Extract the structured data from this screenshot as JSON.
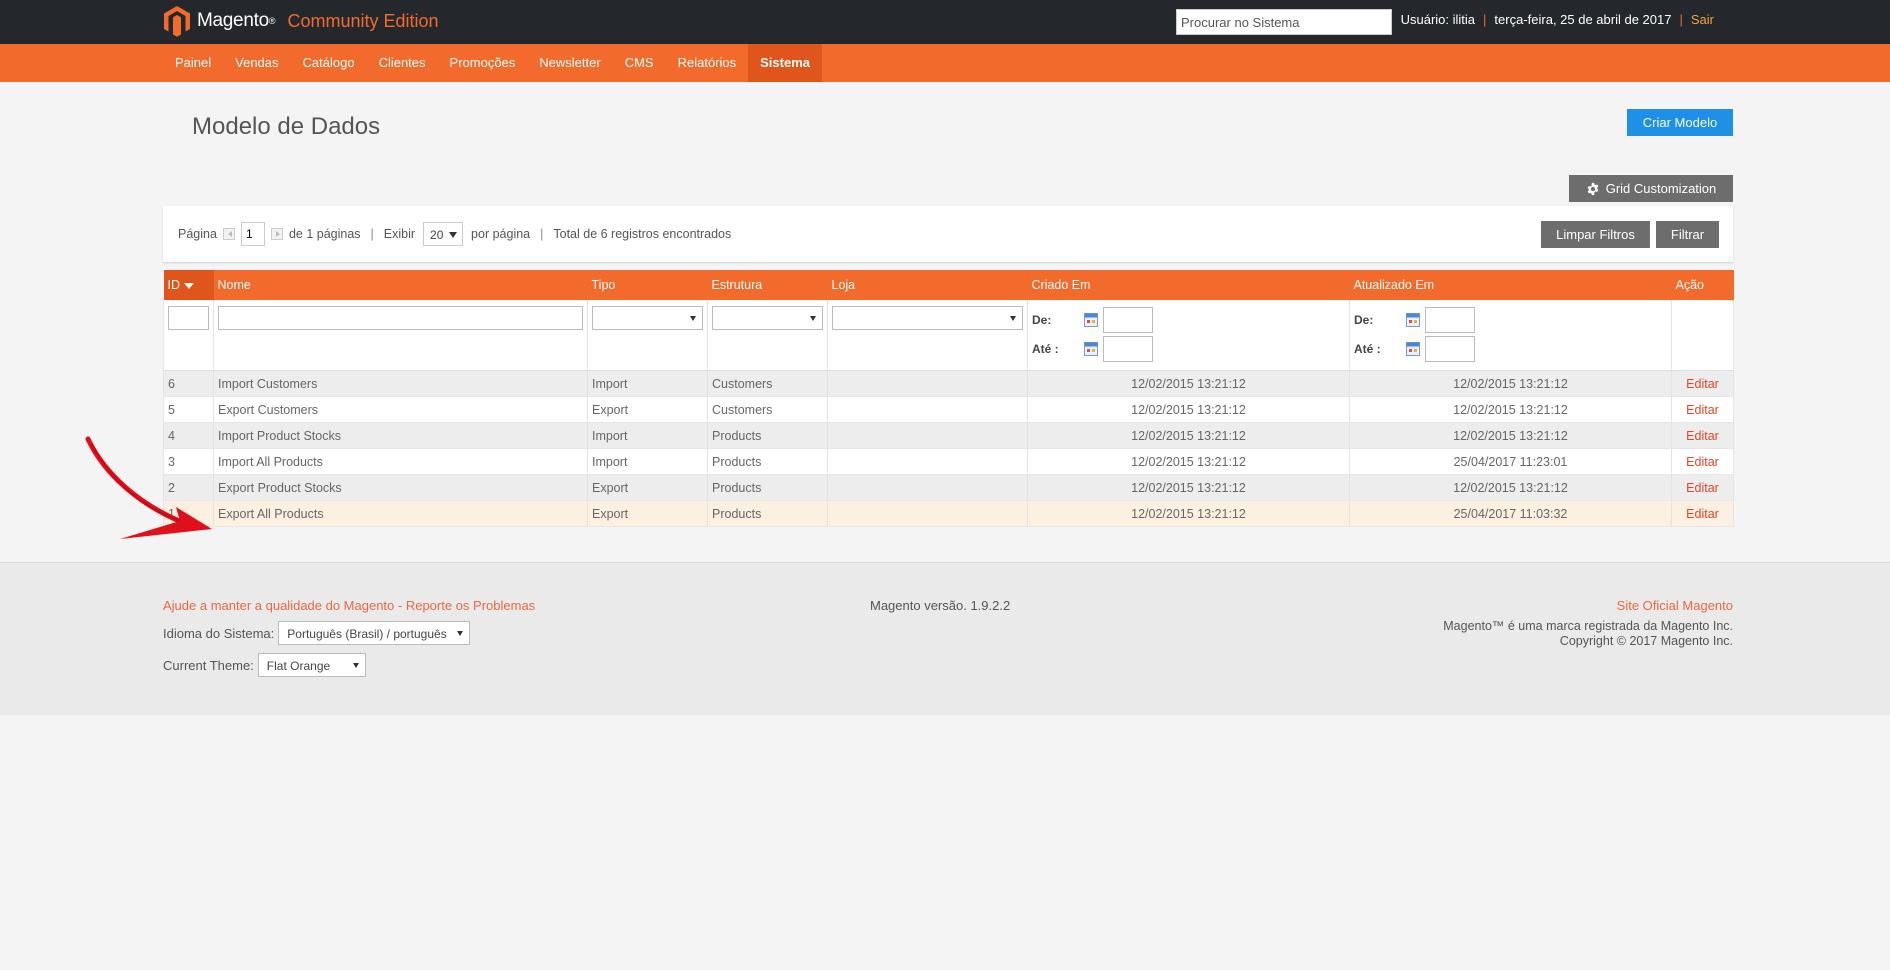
{
  "header": {
    "logo_name": "Magento",
    "logo_tm": "®",
    "edition": "Community Edition",
    "search_placeholder": "Procurar no Sistema",
    "user_text": "Usuário: ilitia",
    "date_text": "terça-feira, 25 de abril de 2017",
    "logout_label": "Sair",
    "separator": "|"
  },
  "nav": {
    "items": [
      "Painel",
      "Vendas",
      "Catálogo",
      "Clientes",
      "Promoções",
      "Newsletter",
      "CMS",
      "Relatórios",
      "Sistema"
    ],
    "active": "Sistema"
  },
  "page": {
    "title": "Modelo de Dados",
    "create_button": "Criar Modelo",
    "grid_customization_button": "Grid Customization"
  },
  "pager": {
    "page_label": "Página",
    "page_value": "1",
    "of_pages": "de 1 páginas",
    "show_label": "Exibir",
    "per_page_value": "20",
    "per_page_label": "por página",
    "total_text": "Total de 6 registros encontrados",
    "clear_filters": "Limpar Filtros",
    "filter": "Filtrar"
  },
  "grid": {
    "columns": [
      "ID",
      "Nome",
      "Tipo",
      "Estrutura",
      "Loja",
      "Criado Em",
      "Atualizado Em",
      "Ação"
    ],
    "date_from_label": "De:",
    "date_to_label": "Até :",
    "rows": [
      {
        "id": "6",
        "name": "Import Customers",
        "type": "Import",
        "structure": "Customers",
        "store": "",
        "created": "12/02/2015 13:21:12",
        "updated": "12/02/2015 13:21:12",
        "action": "Editar"
      },
      {
        "id": "5",
        "name": "Export Customers",
        "type": "Export",
        "structure": "Customers",
        "store": "",
        "created": "12/02/2015 13:21:12",
        "updated": "12/02/2015 13:21:12",
        "action": "Editar"
      },
      {
        "id": "4",
        "name": "Import Product Stocks",
        "type": "Import",
        "structure": "Products",
        "store": "",
        "created": "12/02/2015 13:21:12",
        "updated": "12/02/2015 13:21:12",
        "action": "Editar"
      },
      {
        "id": "3",
        "name": "Import All Products",
        "type": "Import",
        "structure": "Products",
        "store": "",
        "created": "12/02/2015 13:21:12",
        "updated": "25/04/2017 11:23:01",
        "action": "Editar"
      },
      {
        "id": "2",
        "name": "Export Product Stocks",
        "type": "Export",
        "structure": "Products",
        "store": "",
        "created": "12/02/2015 13:21:12",
        "updated": "12/02/2015 13:21:12",
        "action": "Editar"
      },
      {
        "id": "1",
        "name": "Export All Products",
        "type": "Export",
        "structure": "Products",
        "store": "",
        "created": "12/02/2015 13:21:12",
        "updated": "25/04/2017 11:03:32",
        "action": "Editar"
      }
    ],
    "highlighted_row_id": "1"
  },
  "footer": {
    "help_link": "Ajude a manter a qualidade do Magento - Reporte os Problemas",
    "language_label": "Idioma do Sistema:",
    "language_value": "Português (Brasil) / português",
    "theme_label": "Current Theme:",
    "theme_value": "Flat Orange",
    "version": "Magento versão. 1.9.2.2",
    "official_site": "Site Oficial Magento",
    "trademark": "Magento™ é uma marca registrada da Magento Inc.",
    "copyright": "Copyright © 2017 Magento Inc."
  },
  "colors": {
    "topbar": "#24272c",
    "accent_orange": "#f26b2d",
    "create_button_blue": "#1e90e8",
    "annotation_arrow": "#e0101a",
    "highlight_row": "#fcf1e1"
  }
}
